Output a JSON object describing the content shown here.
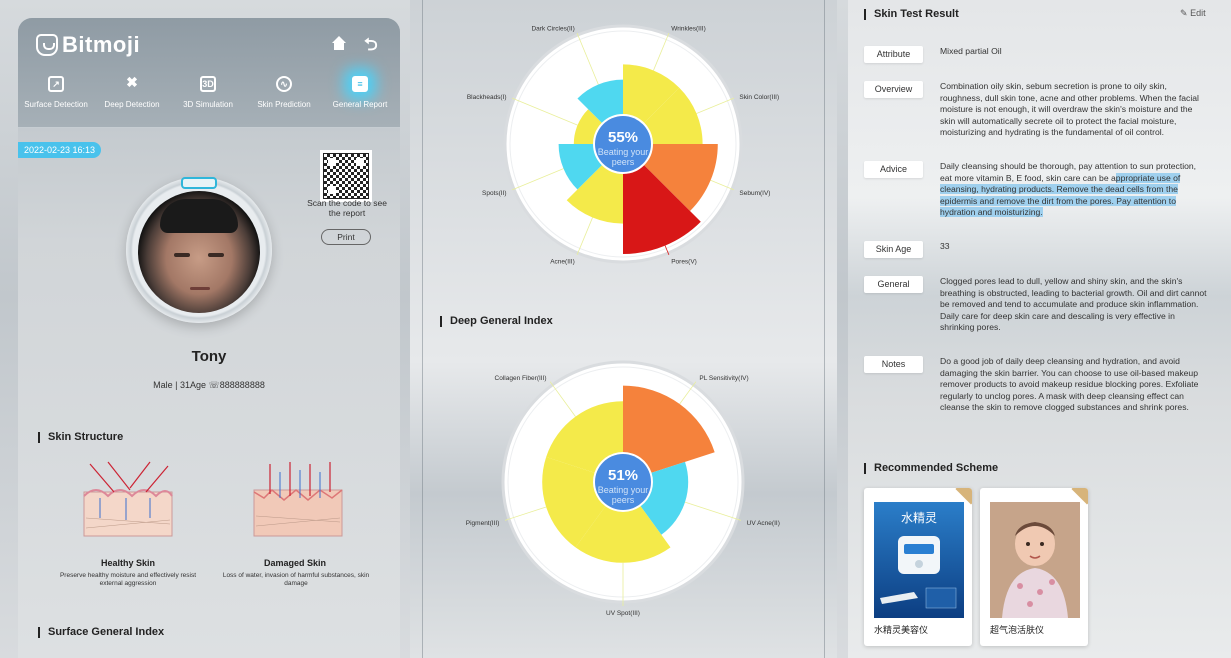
{
  "app": {
    "logo": "Bitmoji",
    "nav": [
      {
        "label": "Surface Detection",
        "icon": "surface-detection-icon"
      },
      {
        "label": "Deep Detection",
        "icon": "deep-detection-icon"
      },
      {
        "label": "3D Simulation",
        "icon": "3d-simulation-icon"
      },
      {
        "label": "Skin Prediction",
        "icon": "skin-prediction-icon"
      },
      {
        "label": "General Report",
        "icon": "general-report-icon",
        "active": true
      }
    ]
  },
  "profile": {
    "date": "2022-02-23 16:13",
    "scan_text": "Scan the code to see the report",
    "print_label": "Print",
    "name": "Tony",
    "info": "Male | 31Age ☏888888888"
  },
  "skin_structure": {
    "title": "Skin Structure",
    "healthy": {
      "label": "Healthy Skin",
      "desc": "Preserve healthy moisture and effectively resist external aggression"
    },
    "damaged": {
      "label": "Damaged Skin",
      "desc": "Loss of water, invasion of harmful substances, skin damage"
    }
  },
  "surface_general_index": {
    "title": "Surface General Index"
  },
  "chart_data": [
    {
      "type": "polar-bar",
      "center_value": "55%",
      "center_text": "Beating your peers",
      "categories": [
        "Wrinkles(III)",
        "Skin Color(III)",
        "Sebum(IV)",
        "Pores(V)",
        "Acne(III)",
        "Spots(II)",
        "Blackheads(I)",
        "Dark Circles(II)"
      ],
      "values": [
        3,
        3,
        4,
        5,
        3,
        2,
        1,
        2
      ],
      "max": 5,
      "colors": [
        "#f4ea4a",
        "#f4ea4a",
        "#f5823c",
        "#d81717",
        "#f4ea4a",
        "#4fd8f0",
        "#f4ea4a",
        "#4fd8f0"
      ]
    },
    {
      "type": "polar-bar",
      "title": "Deep General Index",
      "center_value": "51%",
      "center_text": "Beating your peers",
      "categories": [
        "PL Sensitivity(IV)",
        "UV Acne(II)",
        "UV Spot(III)",
        "Pigment(III)",
        "Collagen Fiber(III)"
      ],
      "values": [
        4,
        2,
        3,
        3,
        3
      ],
      "max": 5,
      "colors": [
        "#f5823c",
        "#4fd8f0",
        "#f4ea4a",
        "#f4ea4a",
        "#f4ea4a"
      ]
    }
  ],
  "report": {
    "title": "Skin Test Result",
    "edit_label": "Edit",
    "rows": [
      {
        "tag": "Attribute",
        "text": "Mixed partial Oil"
      },
      {
        "tag": "Overview",
        "text": "Combination oily skin, sebum secretion is prone to oily skin, roughness, dull skin tone, acne and other problems. When the facial moisture is not enough, it will overdraw the skin's moisture and the skin will automatically secrete oil to protect the facial moisture, moisturizing and hydrating is the fundamental of oil control."
      },
      {
        "tag": "Advice",
        "text_plain": "Daily cleansing should be thorough, pay attention to sun protection, eat more vitamin B, E food, skin care can be a",
        "text_highlight": "ppropriate use of cleansing, hydrating products. Remove the dead cells from the epidermis and remove the dirt from the pores. Pay attention to hydration and moisturizing."
      },
      {
        "tag": "Skin Age",
        "text": "33"
      },
      {
        "tag": "General",
        "text": "Clogged pores lead to dull, yellow and shiny skin, and the skin's breathing is obstructed, leading to bacterial growth. Oil and dirt cannot be removed and tend to accumulate and produce skin inflammation. Daily care for deep skin care and descaling is very effective in shrinking pores."
      },
      {
        "tag": "Notes",
        "text": "Do a good job of daily deep cleansing and hydration, and avoid damaging the skin barrier. You can choose to use oil-based makeup remover products to avoid makeup residue blocking pores. Exfoliate regularly to unclog pores. A mask with deep cleansing effect can cleanse the skin to remove clogged substances and shrink pores."
      }
    ]
  },
  "recommended": {
    "title": "Recommended Scheme",
    "products": [
      {
        "label": "水精灵美容仪",
        "image_text": "水精灵"
      },
      {
        "label": "超气泡活肤仪"
      }
    ]
  }
}
